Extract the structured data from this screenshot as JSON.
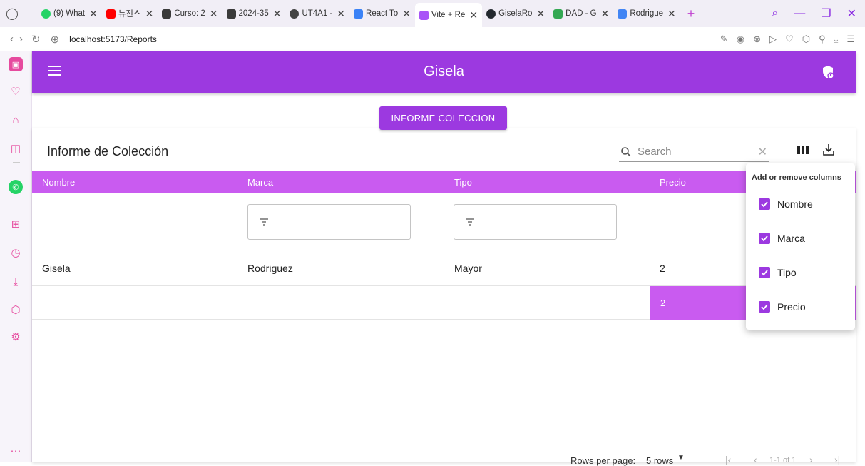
{
  "browser": {
    "tabs": [
      {
        "label": "(9) What",
        "color": "#25d366",
        "active": false
      },
      {
        "label": "뉴진스",
        "color": "#ff0000",
        "active": false
      },
      {
        "label": "Curso: 2",
        "color": "#3a3a3a",
        "active": false
      },
      {
        "label": "2024-35",
        "color": "#3a3a3a",
        "active": false
      },
      {
        "label": "UT4A1 -",
        "color": "#444444",
        "active": false
      },
      {
        "label": "React To",
        "color": "#3b82f6",
        "active": false
      },
      {
        "label": "Vite + Re",
        "color": "#a855f7",
        "active": true
      },
      {
        "label": "GiselaRo",
        "color": "#24292f",
        "active": false
      },
      {
        "label": "DAD - G",
        "color": "#34a853",
        "active": false
      },
      {
        "label": "Rodrigue",
        "color": "#4285f4",
        "active": false
      }
    ],
    "url": "localhost:5173/Reports"
  },
  "appbar": {
    "title": "Gisela"
  },
  "report_button": "INFORME COLECCION",
  "table": {
    "title": "Informe de Colección",
    "search_placeholder": "Search",
    "columns": [
      "Nombre",
      "Marca",
      "Tipo",
      "Precio"
    ],
    "rows": [
      {
        "nombre": "Gisela",
        "marca": "Rodriguez",
        "tipo": "Mayor",
        "precio": "2"
      }
    ],
    "summary_precio": "2",
    "pagination": {
      "rows_per_page_label": "Rows per page:",
      "rows_per_page_value": "5 rows",
      "range": "1-1 of 1"
    }
  },
  "column_menu": {
    "title": "Add or remove columns",
    "items": [
      {
        "label": "Nombre",
        "checked": true
      },
      {
        "label": "Marca",
        "checked": true
      },
      {
        "label": "Tipo",
        "checked": true
      },
      {
        "label": "Precio",
        "checked": true
      }
    ]
  },
  "colors": {
    "primary": "#9c39e0",
    "header": "#c95bf0",
    "sidebar_icon": "#e64a9e"
  }
}
